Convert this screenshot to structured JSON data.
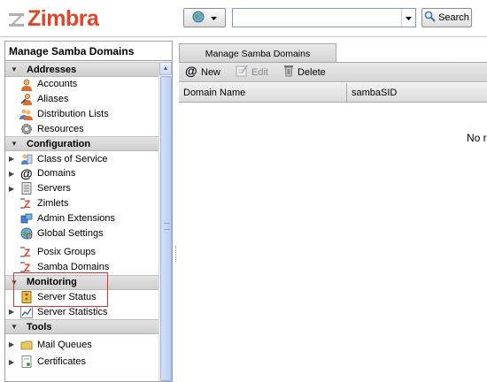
{
  "header": {
    "app_name": "Zimbra",
    "search_placeholder": "",
    "search_button": "Search"
  },
  "left_panel": {
    "title": "Manage Samba Domains",
    "sections": [
      {
        "label": "Addresses",
        "items": [
          {
            "label": "Accounts",
            "icon": "person-icon",
            "expandable": false
          },
          {
            "label": "Aliases",
            "icon": "alias-icon",
            "expandable": false
          },
          {
            "label": "Distribution Lists",
            "icon": "group-icon",
            "expandable": false
          },
          {
            "label": "Resources",
            "icon": "gear-icon",
            "expandable": false
          }
        ]
      },
      {
        "label": "Configuration",
        "items": [
          {
            "label": "Class of Service",
            "icon": "cos-icon",
            "expandable": true
          },
          {
            "label": "Domains",
            "icon": "at-icon",
            "expandable": true
          },
          {
            "label": "Servers",
            "icon": "server-icon",
            "expandable": true
          },
          {
            "label": "Zimlets",
            "icon": "zimlet-icon",
            "expandable": false
          },
          {
            "label": "Admin Extensions",
            "icon": "extension-icon",
            "expandable": false
          },
          {
            "label": "Global Settings",
            "icon": "globe-icon",
            "expandable": false
          },
          {
            "label": "Posix Groups",
            "icon": "zimlet-icon",
            "expandable": false
          },
          {
            "label": "Samba Domains",
            "icon": "zimlet-icon",
            "expandable": false
          }
        ]
      },
      {
        "label": "Monitoring",
        "items": [
          {
            "label": "Server Status",
            "icon": "status-icon",
            "expandable": false
          },
          {
            "label": "Server Statistics",
            "icon": "chart-icon",
            "expandable": true
          }
        ]
      },
      {
        "label": "Tools",
        "items": [
          {
            "label": "Mail Queues",
            "icon": "folder-icon",
            "expandable": true
          },
          {
            "label": "Certificates",
            "icon": "certificate-icon",
            "expandable": true
          }
        ]
      }
    ]
  },
  "main": {
    "tab_label": "Manage Samba Domains",
    "toolbar": {
      "new_label": "New",
      "edit_label": "Edit",
      "delete_label": "Delete"
    },
    "columns": [
      "Domain Name",
      "sambaSID"
    ],
    "empty_text": "No r"
  },
  "colors": {
    "brand": "#e0442a",
    "highlight_box": "#e03030"
  }
}
